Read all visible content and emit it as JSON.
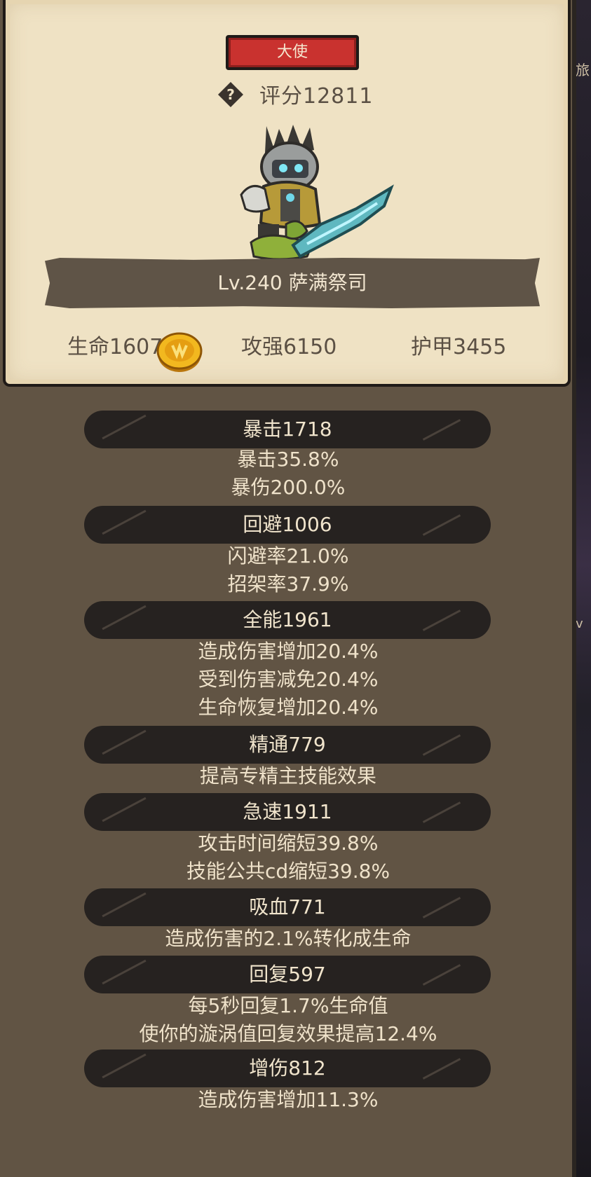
{
  "card": {
    "rank": "大使",
    "score": "评分12811",
    "name": "Lv.240 萨满祭司",
    "stats": {
      "hp": "生命1607",
      "attack": "攻强6150",
      "armor": "护甲3455"
    }
  },
  "attributes": [
    {
      "header": "暴击1718",
      "lines": [
        "暴击35.8%",
        "暴伤200.0%"
      ]
    },
    {
      "header": "回避1006",
      "lines": [
        "闪避率21.0%",
        "招架率37.9%"
      ]
    },
    {
      "header": "全能1961",
      "lines": [
        "造成伤害增加20.4%",
        "受到伤害减免20.4%",
        "生命恢复增加20.4%"
      ]
    },
    {
      "header": "精通779",
      "lines": [
        "提高专精主技能效果"
      ]
    },
    {
      "header": "急速1911",
      "lines": [
        "攻击时间缩短39.8%",
        "技能公共cd缩短39.8%"
      ]
    },
    {
      "header": "吸血771",
      "lines": [
        "造成伤害的2.1%转化成生命"
      ]
    },
    {
      "header": "回复597",
      "lines": [
        "每5秒回复1.7%生命值",
        "使你的漩涡值回复效果提高12.4%"
      ]
    },
    {
      "header": "增伤812",
      "lines": [
        "造成伤害增加11.3%"
      ]
    }
  ],
  "colors": {
    "parchment": "#efe2c4",
    "panel": "#615444",
    "rank_badge": "#c9322f",
    "header_bar": "#262220",
    "text_light": "#efe2ca",
    "text_dark": "#5b5044"
  },
  "icons": [
    "help-icon",
    "hero-sprite",
    "coin-icon"
  ]
}
